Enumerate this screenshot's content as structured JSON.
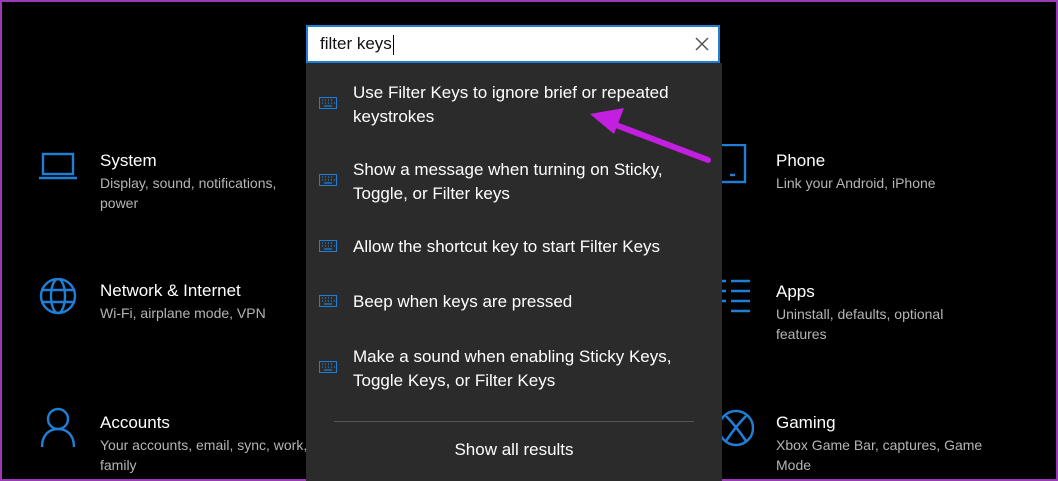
{
  "colors": {
    "accent": "#1f7fd6",
    "frame": "#9b3ab8",
    "annotation_arrow": "#c21fe0",
    "dropdown_bg": "#2b2b2b"
  },
  "search": {
    "value": "filter keys",
    "clear_icon": "close-icon"
  },
  "results": [
    {
      "label": "Use Filter Keys to ignore brief or repeated keystrokes",
      "icon": "keyboard-icon"
    },
    {
      "label": "Show a message when turning on Sticky, Toggle, or Filter keys",
      "icon": "keyboard-icon"
    },
    {
      "label": "Allow the shortcut key to start Filter Keys",
      "icon": "keyboard-icon"
    },
    {
      "label": "Beep when keys are pressed",
      "icon": "keyboard-icon"
    },
    {
      "label": "Make a sound when enabling Sticky Keys, Toggle Keys, or Filter Keys",
      "icon": "keyboard-icon"
    }
  ],
  "show_all_label": "Show all results",
  "tiles": {
    "system": {
      "title": "System",
      "desc": "Display, sound, notifications, power",
      "icon": "laptop-icon"
    },
    "network": {
      "title": "Network & Internet",
      "desc": "Wi-Fi, airplane mode, VPN",
      "icon": "globe-icon"
    },
    "accounts": {
      "title": "Accounts",
      "desc": "Your accounts, email, sync, work, family",
      "icon": "person-icon"
    },
    "phone": {
      "title": "Phone",
      "desc": "Link your Android, iPhone",
      "icon": "phone-icon"
    },
    "apps": {
      "title": "Apps",
      "desc": "Uninstall, defaults, optional features",
      "icon": "apps-list-icon"
    },
    "gaming": {
      "title": "Gaming",
      "desc": "Xbox Game Bar, captures, Game Mode",
      "icon": "xbox-icon"
    }
  }
}
